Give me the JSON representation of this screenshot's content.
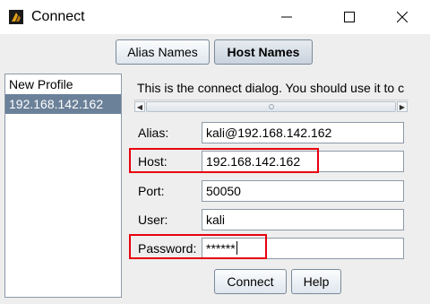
{
  "window": {
    "title": "Connect",
    "icon": "cobalt-strike-app-icon"
  },
  "tabs": [
    {
      "label": "Alias Names",
      "active": false
    },
    {
      "label": "Host Names",
      "active": true
    }
  ],
  "profiles": [
    {
      "label": "New Profile",
      "selected": false
    },
    {
      "label": "192.168.142.162",
      "selected": true
    }
  ],
  "description": "This is the connect dialog. You should use it to c",
  "form": {
    "alias": {
      "label": "Alias:",
      "value": "kali@192.168.142.162"
    },
    "host": {
      "label": "Host:",
      "value": "192.168.142.162"
    },
    "port": {
      "label": "Port:",
      "value": "50050"
    },
    "user": {
      "label": "User:",
      "value": "kali"
    },
    "password": {
      "label": "Password:",
      "value": "******"
    }
  },
  "buttons": {
    "connect": "Connect",
    "help": "Help"
  },
  "colors": {
    "highlight": "#e8000e",
    "selection": "#6b8199"
  }
}
